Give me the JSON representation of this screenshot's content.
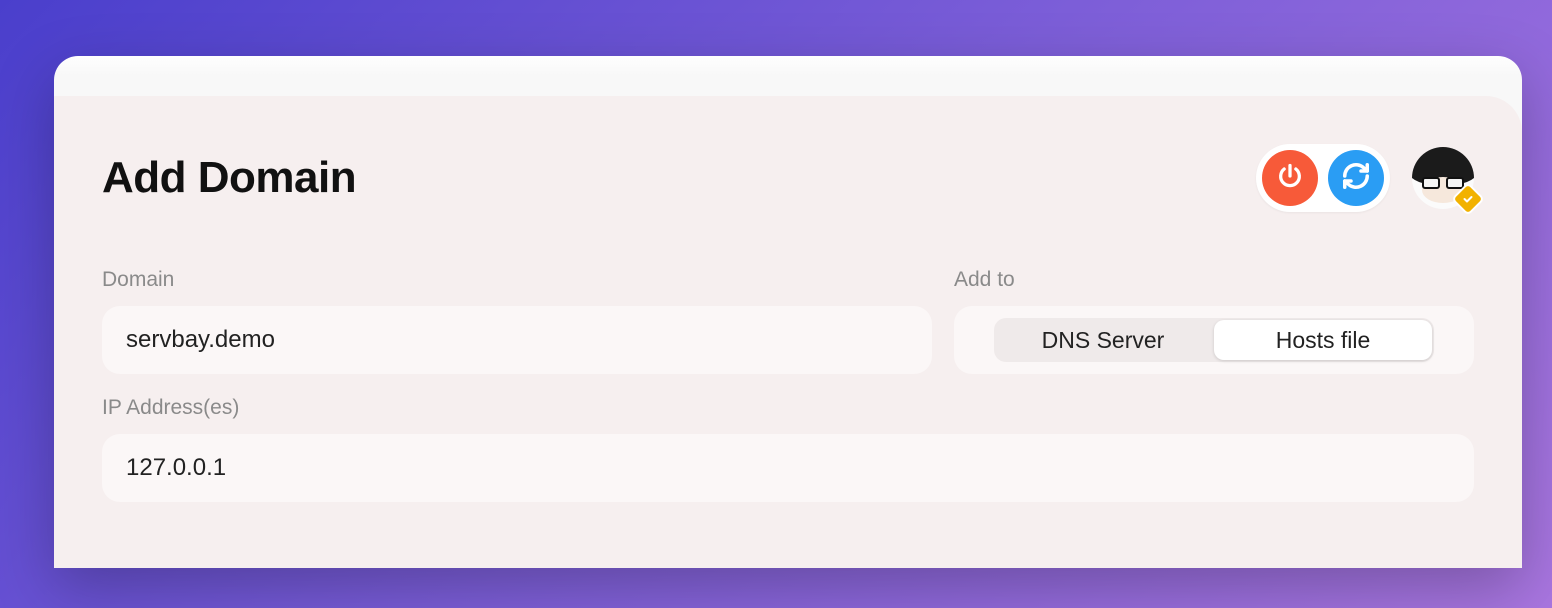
{
  "header": {
    "title": "Add Domain"
  },
  "form": {
    "domain": {
      "label": "Domain",
      "value": "servbay.demo"
    },
    "add_to": {
      "label": "Add to",
      "options": [
        "DNS Server",
        "Hosts file"
      ],
      "selected": "Hosts file"
    },
    "ip": {
      "label": "IP Address(es)",
      "value": "127.0.0.1"
    }
  },
  "colors": {
    "power": "#f75a39",
    "refresh": "#2a9df4",
    "badge": "#f2b200"
  }
}
